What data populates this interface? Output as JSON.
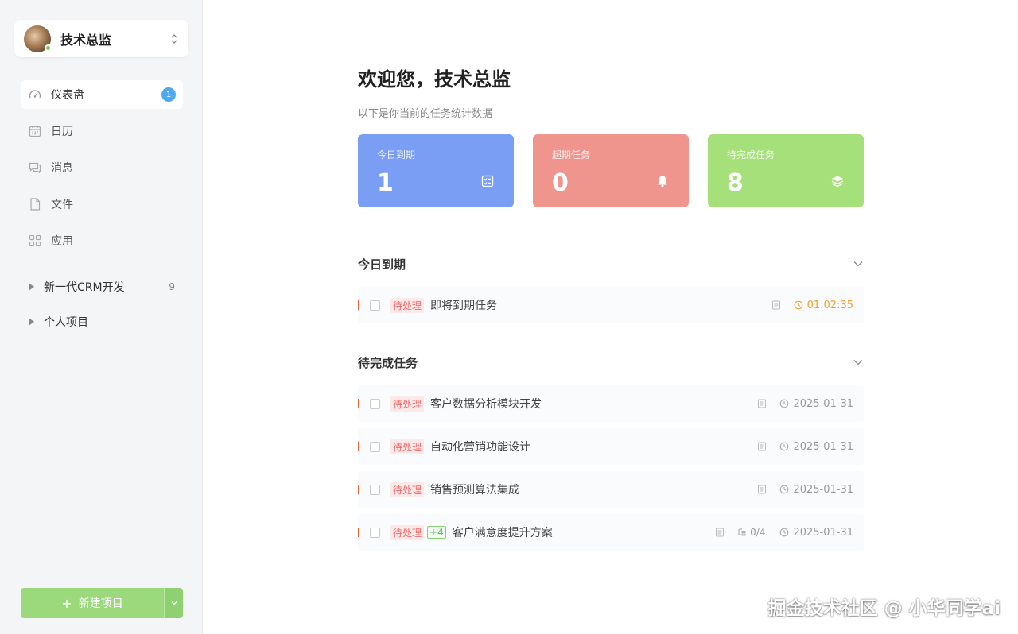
{
  "user": {
    "name": "技术总监"
  },
  "nav": {
    "items": [
      {
        "label": "仪表盘",
        "badge": "1",
        "icon": "dashboard-icon"
      },
      {
        "label": "日历",
        "icon": "calendar-icon"
      },
      {
        "label": "消息",
        "icon": "message-icon"
      },
      {
        "label": "文件",
        "icon": "file-icon"
      },
      {
        "label": "应用",
        "icon": "apps-icon"
      }
    ]
  },
  "projects": [
    {
      "label": "新一代CRM开发",
      "count": "9"
    },
    {
      "label": "个人项目"
    }
  ],
  "new_project": {
    "label": "新建项目"
  },
  "main": {
    "welcome": "欢迎您，技术总监",
    "subtitle": "以下是你当前的任务统计数据"
  },
  "stats": [
    {
      "label": "今日到期",
      "value": "1",
      "color": "#7b9ef5",
      "icon": "checklist-icon"
    },
    {
      "label": "超期任务",
      "value": "0",
      "color": "#f0958d",
      "icon": "bell-icon"
    },
    {
      "label": "待完成任务",
      "value": "8",
      "color": "#a6e07a",
      "icon": "layers-icon"
    }
  ],
  "sections": {
    "today": {
      "title": "今日到期",
      "tasks": [
        {
          "tag": "待处理",
          "title": "即将到期任务",
          "time": "01:02:35"
        }
      ]
    },
    "pending": {
      "title": "待完成任务",
      "tasks": [
        {
          "tag": "待处理",
          "title": "客户数据分析模块开发",
          "date": "2025-01-31"
        },
        {
          "tag": "待处理",
          "title": "自动化营销功能设计",
          "date": "2025-01-31"
        },
        {
          "tag": "待处理",
          "title": "销售预测算法集成",
          "date": "2025-01-31"
        },
        {
          "tag": "待处理",
          "extra": "+4",
          "title": "客户满意度提升方案",
          "subtasks": "0/4",
          "date": "2025-01-31"
        }
      ]
    }
  },
  "watermark": "掘金技术社区 @ 小华同学ai"
}
